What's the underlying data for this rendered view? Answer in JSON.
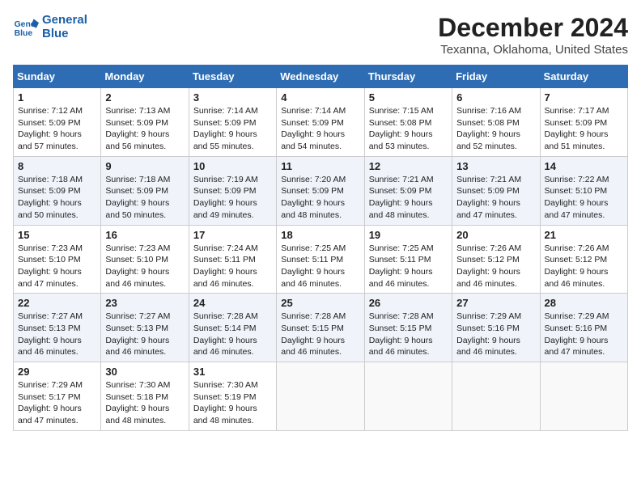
{
  "logo": {
    "line1": "General",
    "line2": "Blue"
  },
  "title": "December 2024",
  "subtitle": "Texanna, Oklahoma, United States",
  "weekdays": [
    "Sunday",
    "Monday",
    "Tuesday",
    "Wednesday",
    "Thursday",
    "Friday",
    "Saturday"
  ],
  "weeks": [
    [
      {
        "day": "1",
        "info": "Sunrise: 7:12 AM\nSunset: 5:09 PM\nDaylight: 9 hours\nand 57 minutes."
      },
      {
        "day": "2",
        "info": "Sunrise: 7:13 AM\nSunset: 5:09 PM\nDaylight: 9 hours\nand 56 minutes."
      },
      {
        "day": "3",
        "info": "Sunrise: 7:14 AM\nSunset: 5:09 PM\nDaylight: 9 hours\nand 55 minutes."
      },
      {
        "day": "4",
        "info": "Sunrise: 7:14 AM\nSunset: 5:09 PM\nDaylight: 9 hours\nand 54 minutes."
      },
      {
        "day": "5",
        "info": "Sunrise: 7:15 AM\nSunset: 5:08 PM\nDaylight: 9 hours\nand 53 minutes."
      },
      {
        "day": "6",
        "info": "Sunrise: 7:16 AM\nSunset: 5:08 PM\nDaylight: 9 hours\nand 52 minutes."
      },
      {
        "day": "7",
        "info": "Sunrise: 7:17 AM\nSunset: 5:09 PM\nDaylight: 9 hours\nand 51 minutes."
      }
    ],
    [
      {
        "day": "8",
        "info": "Sunrise: 7:18 AM\nSunset: 5:09 PM\nDaylight: 9 hours\nand 50 minutes."
      },
      {
        "day": "9",
        "info": "Sunrise: 7:18 AM\nSunset: 5:09 PM\nDaylight: 9 hours\nand 50 minutes."
      },
      {
        "day": "10",
        "info": "Sunrise: 7:19 AM\nSunset: 5:09 PM\nDaylight: 9 hours\nand 49 minutes."
      },
      {
        "day": "11",
        "info": "Sunrise: 7:20 AM\nSunset: 5:09 PM\nDaylight: 9 hours\nand 48 minutes."
      },
      {
        "day": "12",
        "info": "Sunrise: 7:21 AM\nSunset: 5:09 PM\nDaylight: 9 hours\nand 48 minutes."
      },
      {
        "day": "13",
        "info": "Sunrise: 7:21 AM\nSunset: 5:09 PM\nDaylight: 9 hours\nand 47 minutes."
      },
      {
        "day": "14",
        "info": "Sunrise: 7:22 AM\nSunset: 5:10 PM\nDaylight: 9 hours\nand 47 minutes."
      }
    ],
    [
      {
        "day": "15",
        "info": "Sunrise: 7:23 AM\nSunset: 5:10 PM\nDaylight: 9 hours\nand 47 minutes."
      },
      {
        "day": "16",
        "info": "Sunrise: 7:23 AM\nSunset: 5:10 PM\nDaylight: 9 hours\nand 46 minutes."
      },
      {
        "day": "17",
        "info": "Sunrise: 7:24 AM\nSunset: 5:11 PM\nDaylight: 9 hours\nand 46 minutes."
      },
      {
        "day": "18",
        "info": "Sunrise: 7:25 AM\nSunset: 5:11 PM\nDaylight: 9 hours\nand 46 minutes."
      },
      {
        "day": "19",
        "info": "Sunrise: 7:25 AM\nSunset: 5:11 PM\nDaylight: 9 hours\nand 46 minutes."
      },
      {
        "day": "20",
        "info": "Sunrise: 7:26 AM\nSunset: 5:12 PM\nDaylight: 9 hours\nand 46 minutes."
      },
      {
        "day": "21",
        "info": "Sunrise: 7:26 AM\nSunset: 5:12 PM\nDaylight: 9 hours\nand 46 minutes."
      }
    ],
    [
      {
        "day": "22",
        "info": "Sunrise: 7:27 AM\nSunset: 5:13 PM\nDaylight: 9 hours\nand 46 minutes."
      },
      {
        "day": "23",
        "info": "Sunrise: 7:27 AM\nSunset: 5:13 PM\nDaylight: 9 hours\nand 46 minutes."
      },
      {
        "day": "24",
        "info": "Sunrise: 7:28 AM\nSunset: 5:14 PM\nDaylight: 9 hours\nand 46 minutes."
      },
      {
        "day": "25",
        "info": "Sunrise: 7:28 AM\nSunset: 5:15 PM\nDaylight: 9 hours\nand 46 minutes."
      },
      {
        "day": "26",
        "info": "Sunrise: 7:28 AM\nSunset: 5:15 PM\nDaylight: 9 hours\nand 46 minutes."
      },
      {
        "day": "27",
        "info": "Sunrise: 7:29 AM\nSunset: 5:16 PM\nDaylight: 9 hours\nand 46 minutes."
      },
      {
        "day": "28",
        "info": "Sunrise: 7:29 AM\nSunset: 5:16 PM\nDaylight: 9 hours\nand 47 minutes."
      }
    ],
    [
      {
        "day": "29",
        "info": "Sunrise: 7:29 AM\nSunset: 5:17 PM\nDaylight: 9 hours\nand 47 minutes."
      },
      {
        "day": "30",
        "info": "Sunrise: 7:30 AM\nSunset: 5:18 PM\nDaylight: 9 hours\nand 48 minutes."
      },
      {
        "day": "31",
        "info": "Sunrise: 7:30 AM\nSunset: 5:19 PM\nDaylight: 9 hours\nand 48 minutes."
      },
      {
        "day": "",
        "info": ""
      },
      {
        "day": "",
        "info": ""
      },
      {
        "day": "",
        "info": ""
      },
      {
        "day": "",
        "info": ""
      }
    ]
  ]
}
